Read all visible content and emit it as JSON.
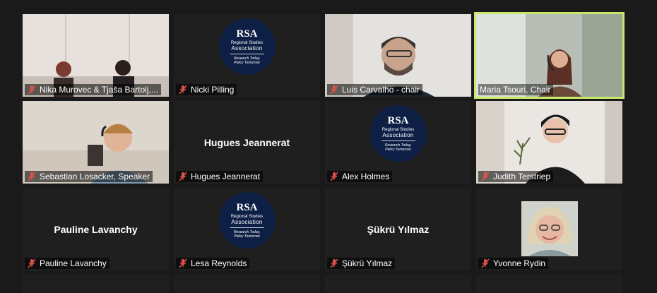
{
  "participants": [
    {
      "name": "Nika Murovec & Tjaša Bartolj,...",
      "type": "video"
    },
    {
      "name": "Nicki Pilling",
      "type": "logo"
    },
    {
      "name": "Luis Carvalho - chair",
      "type": "video"
    },
    {
      "name": "Maria Tsouri, Chair",
      "type": "video",
      "active_speaker": true
    },
    {
      "name": "Sebastian Losacker, Speaker",
      "type": "video"
    },
    {
      "name": "Hugues Jeannerat",
      "display_name": "Hugues Jeannerat",
      "type": "name"
    },
    {
      "name": "Alex Holmes",
      "type": "logo"
    },
    {
      "name": "Judith Terstriep",
      "type": "video"
    },
    {
      "name": "Pauline Lavanchy",
      "display_name": "Pauline Lavanchy",
      "type": "name"
    },
    {
      "name": "Lesa Reynolds",
      "type": "logo"
    },
    {
      "name": "Şükrü Yılmaz",
      "display_name": "Şükrü Yılmaz",
      "type": "name"
    },
    {
      "name": "Yvonne Rydin",
      "type": "photo"
    }
  ],
  "logo": {
    "mark": "RSA",
    "org_line1": "Regional Studies",
    "org_line2": "Association",
    "tagline1": "Research Today,",
    "tagline2": "Policy Tomorrow"
  },
  "icons": {
    "muted": "mic-muted-icon"
  },
  "colors": {
    "background": "#1a1a1a",
    "tile": "#1f1f1f",
    "active_speaker_border": "#c7e86a",
    "muted_icon": "#e0524a",
    "logo_bg": "#0d1f45"
  }
}
